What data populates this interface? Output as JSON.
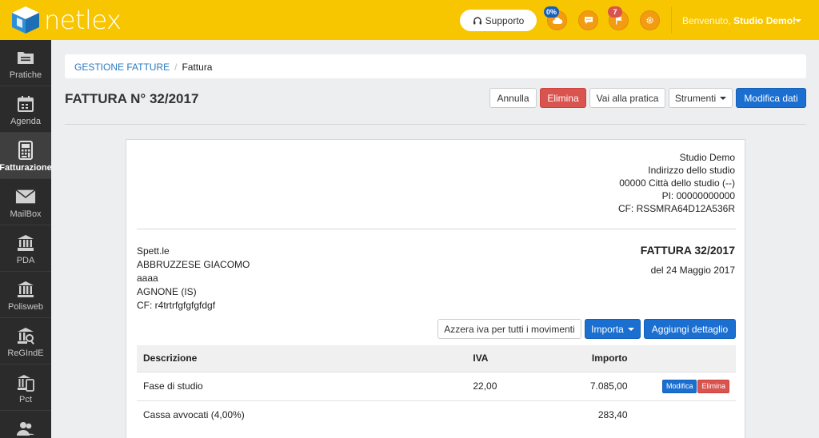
{
  "app": {
    "logo_text": "netlex"
  },
  "topbar": {
    "support_label": "Supporto",
    "cloud_badge": "0%",
    "flag_badge": "7",
    "welcome_prefix": "Benvenuto, ",
    "welcome_user": "Studio Demo!"
  },
  "sidebar": {
    "items": [
      {
        "label": "Pratiche",
        "icon": "folder-icon"
      },
      {
        "label": "Agenda",
        "icon": "calendar-icon"
      },
      {
        "label": "Fatturazione",
        "icon": "calculator-icon",
        "active": true
      },
      {
        "label": "MailBox",
        "icon": "envelope-icon"
      },
      {
        "label": "PDA",
        "icon": "courthouse-pda-icon"
      },
      {
        "label": "Polisweb",
        "icon": "courthouse-icon"
      },
      {
        "label": "ReGIndE",
        "icon": "building-search-icon"
      },
      {
        "label": "Pct",
        "icon": "court-phone-icon"
      }
    ]
  },
  "breadcrumb": {
    "root": "GESTIONE FATTURE",
    "current": "Fattura"
  },
  "page": {
    "title": "FATTURA N° 32/2017",
    "actions": {
      "annulla": "Annulla",
      "elimina": "Elimina",
      "vai_pratica": "Vai alla pratica",
      "strumenti": "Strumenti",
      "modifica": "Modifica dati"
    }
  },
  "document": {
    "studio": {
      "name": "Studio Demo",
      "address": "Indirizzo dello studio",
      "city": "00000 Città dello studio (--)",
      "piva": "PI: 00000000000",
      "cf": "CF: RSSMRA64D12A536R"
    },
    "client": {
      "greeting": "Spett.le",
      "name": "ABBRUZZESE GIACOMO",
      "line2": "aaaa",
      "city": "AGNONE (IS)",
      "cf": "CF: r4trtrfgfgfgfdgf"
    },
    "invoice_title": "FATTURA 32/2017",
    "invoice_date": "del 24 Maggio 2017",
    "buttons": {
      "azzera": "Azzera iva per tutti i movimenti",
      "importa": "Importa",
      "aggiungi": "Aggiungi dettaglio"
    },
    "table": {
      "headers": [
        "Descrizione",
        "IVA",
        "Importo"
      ],
      "rows": [
        {
          "descrizione": "Fase di studio",
          "iva": "22,00",
          "importo": "7.085,00",
          "edit": "Modifica",
          "delete": "Elimina"
        },
        {
          "descrizione": "Cassa avvocati (4,00%)",
          "iva": "",
          "importo": "283,40"
        }
      ]
    }
  },
  "colors": {
    "topbar": "#f7c600",
    "sidebar": "#2b2b2b",
    "primary": "#1a6fd0",
    "danger": "#d9534f",
    "accent_round": "#f39c12"
  }
}
